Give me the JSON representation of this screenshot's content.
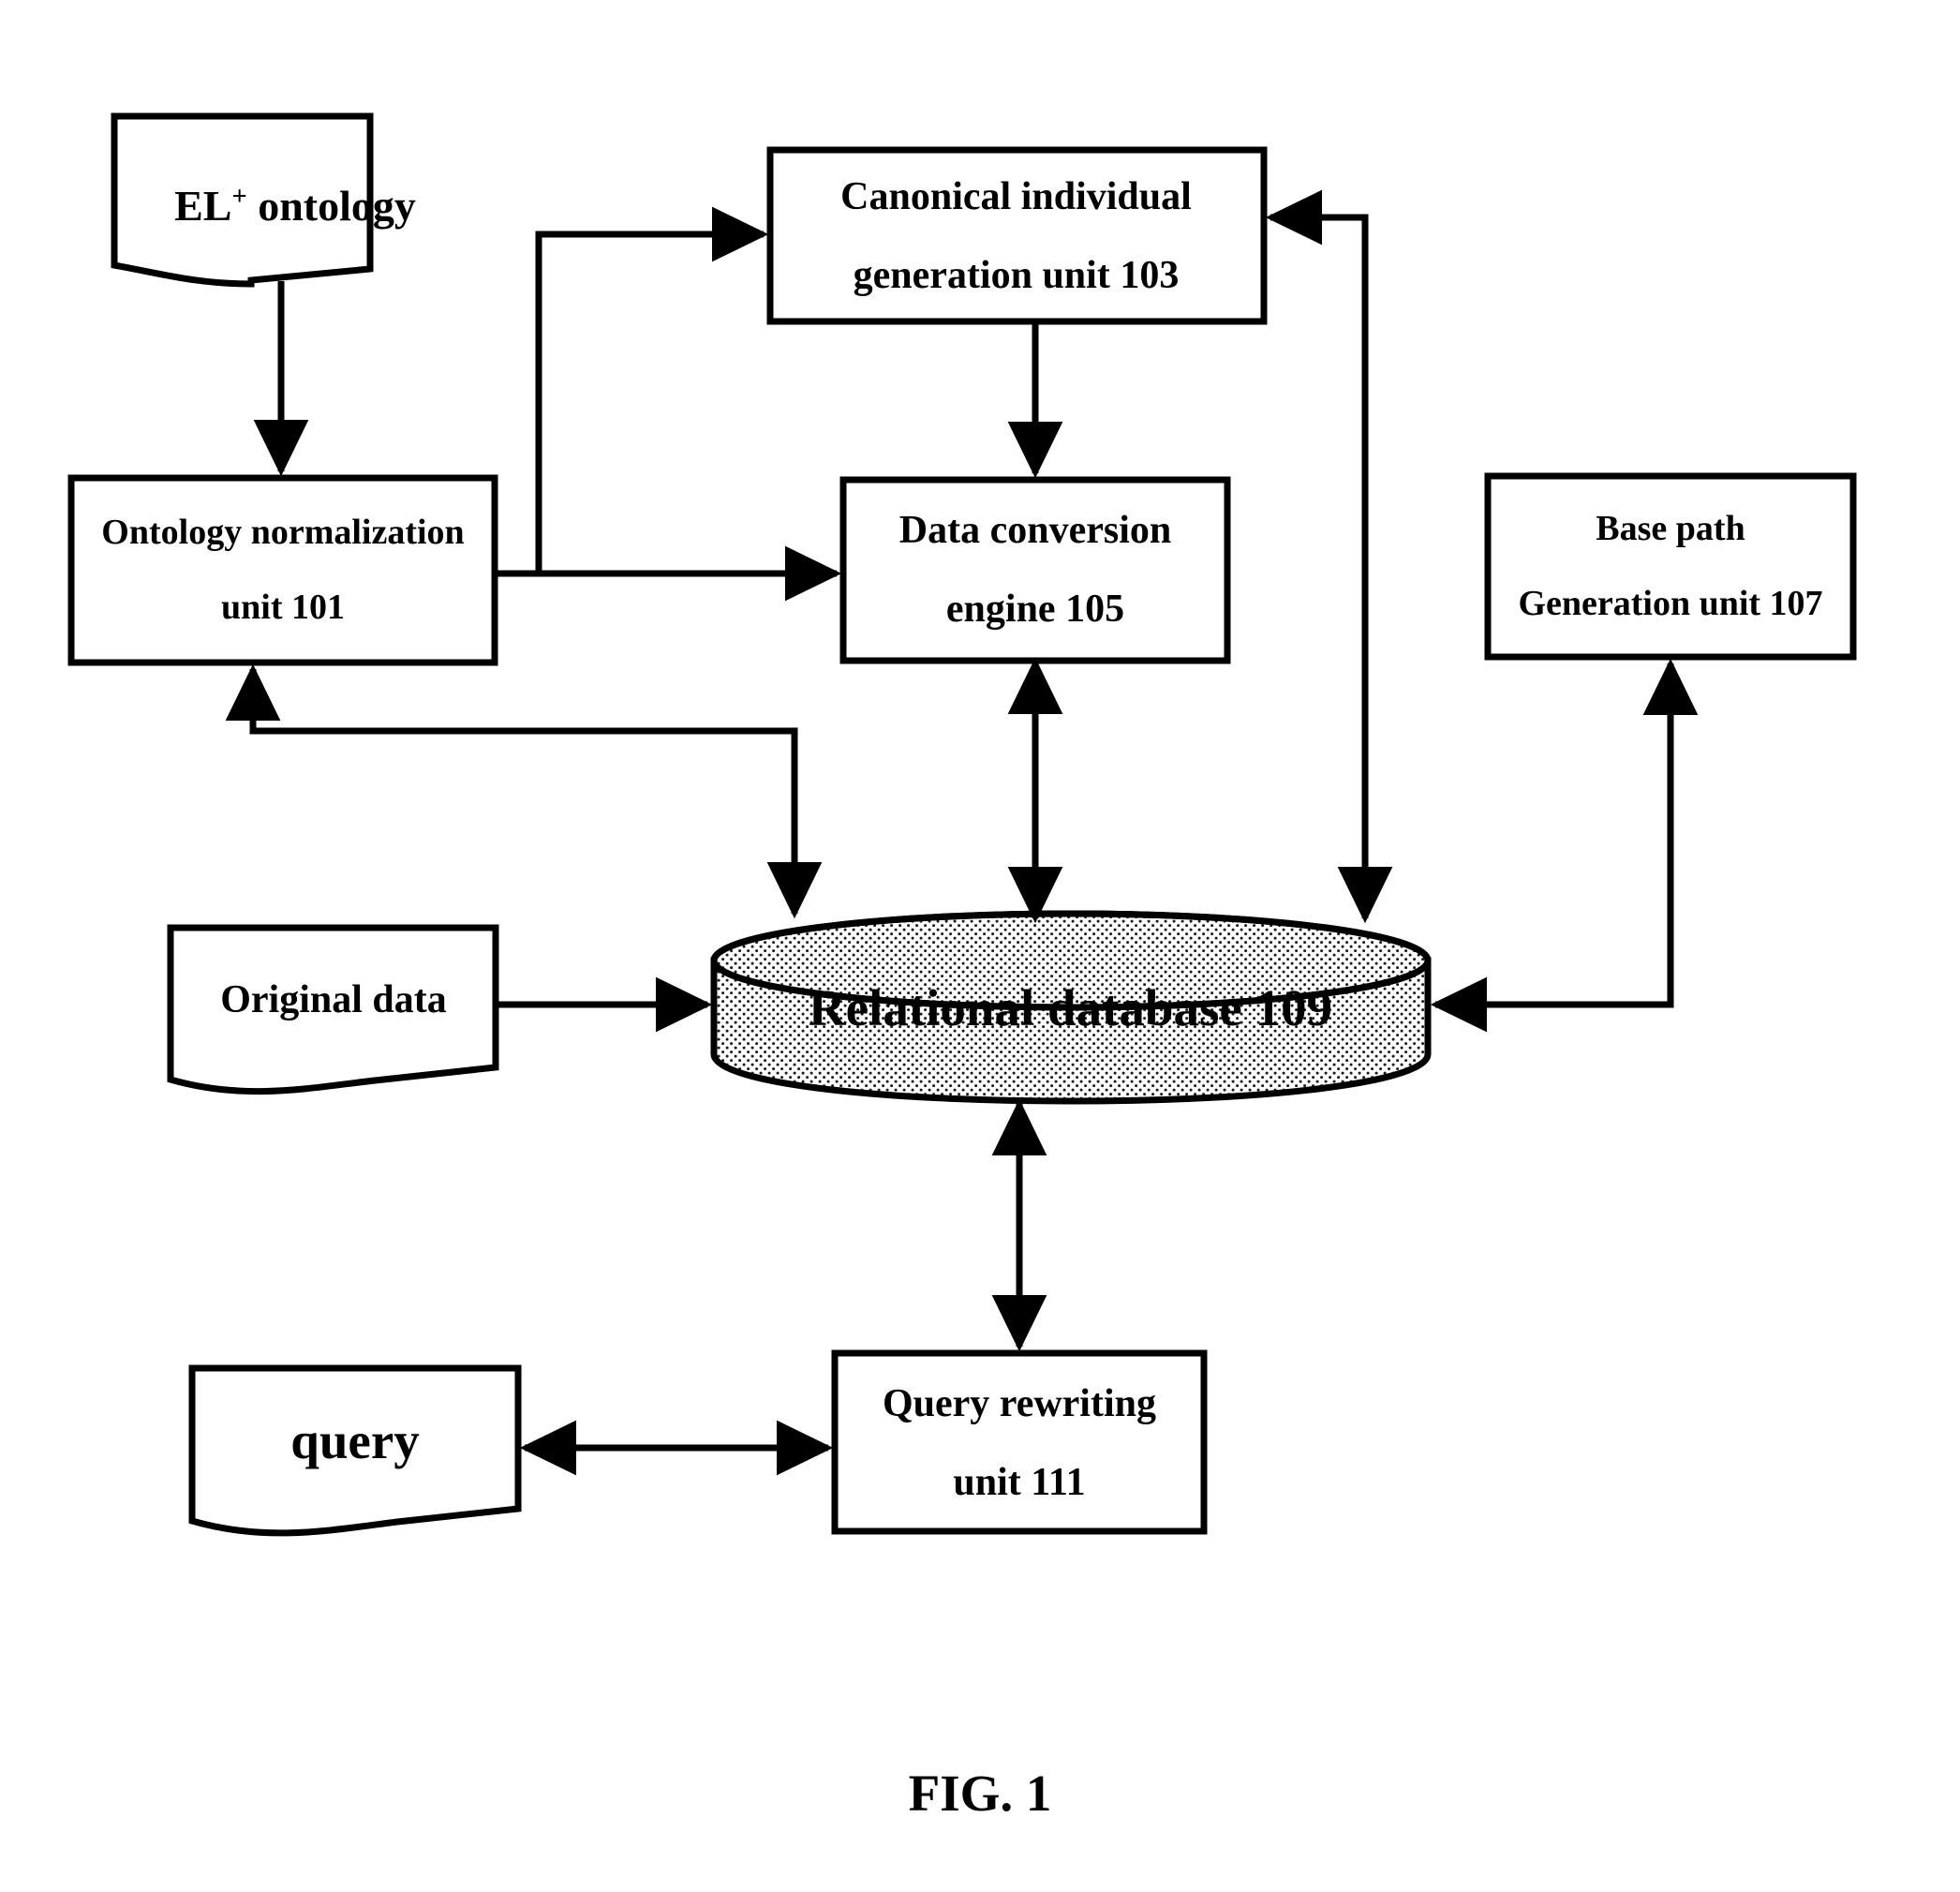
{
  "figure": {
    "caption": "FIG. 1",
    "nodes": {
      "el_ontology": {
        "label_main": "EL",
        "label_sup": "+",
        "label_rest": " ontology",
        "shape": "document"
      },
      "canonical_generation": {
        "line1": "Canonical individual",
        "line2": "generation unit 103",
        "shape": "rectangle"
      },
      "ontology_normalization": {
        "line1": "Ontology normalization",
        "line2": "unit 101",
        "shape": "rectangle"
      },
      "data_conversion": {
        "line1": "Data conversion",
        "line2": "engine 105",
        "shape": "rectangle"
      },
      "base_path_generation": {
        "line1": "Base path",
        "line2": "Generation unit 107",
        "shape": "rectangle"
      },
      "original_data": {
        "line1": "Original data",
        "shape": "document"
      },
      "relational_database": {
        "line1": "Relational database 109",
        "shape": "cylinder"
      },
      "query": {
        "line1": "query",
        "shape": "document"
      },
      "query_rewriting": {
        "line1": "Query rewriting",
        "line2": "unit 111",
        "shape": "rectangle"
      }
    },
    "connections": [
      {
        "from": "el_ontology",
        "to": "ontology_normalization",
        "style": "arrow"
      },
      {
        "from": "ontology_normalization",
        "to": "canonical_generation",
        "style": "arrow"
      },
      {
        "from": "ontology_normalization",
        "to": "data_conversion",
        "style": "arrow"
      },
      {
        "from": "canonical_generation",
        "to": "data_conversion",
        "style": "arrow"
      },
      {
        "from": "ontology_normalization",
        "to": "relational_database",
        "style": "double-arrow"
      },
      {
        "from": "data_conversion",
        "to": "relational_database",
        "style": "double-arrow"
      },
      {
        "from": "relational_database",
        "to": "canonical_generation",
        "style": "arrow"
      },
      {
        "from": "original_data",
        "to": "relational_database",
        "style": "arrow"
      },
      {
        "from": "base_path_generation",
        "to": "relational_database",
        "style": "double-arrow"
      },
      {
        "from": "relational_database",
        "to": "query_rewriting",
        "style": "double-arrow"
      },
      {
        "from": "query_rewriting",
        "to": "query",
        "style": "double-arrow"
      }
    ],
    "colors": {
      "stroke": "#000000",
      "background": "#ffffff",
      "cylinder_fill": "#d9d9d9"
    }
  }
}
